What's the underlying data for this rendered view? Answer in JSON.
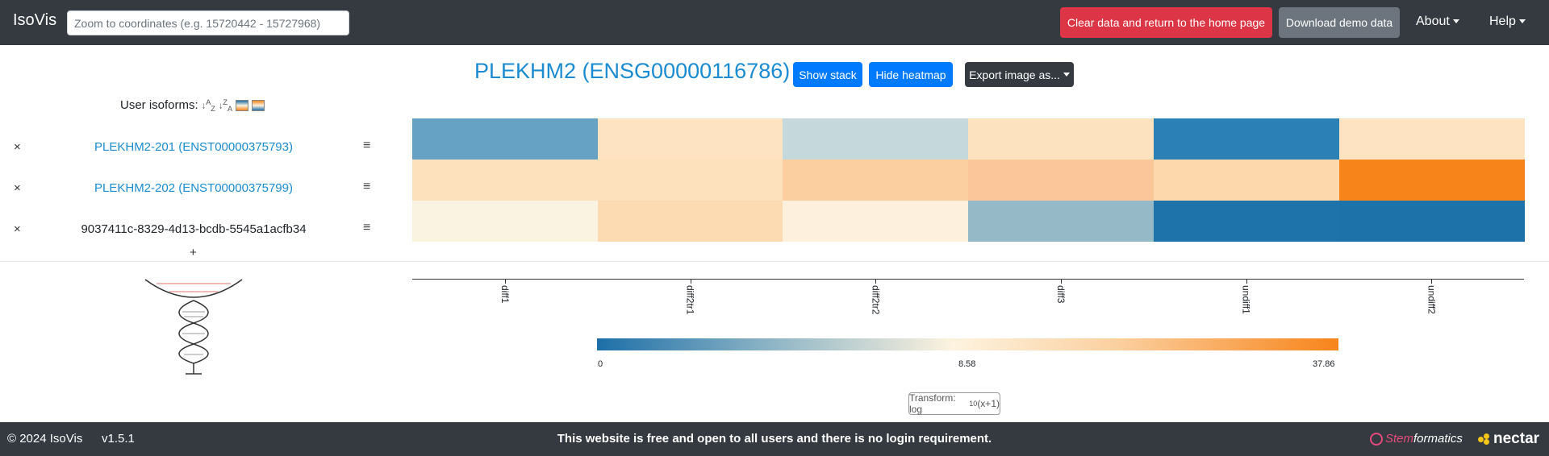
{
  "navbar": {
    "brand": "IsoVis",
    "search_placeholder": "Zoom to coordinates (e.g. 15720442 - 15727968)",
    "clear_button": "Clear data and return to the home page",
    "download_button": "Download demo data",
    "about": "About",
    "help": "Help"
  },
  "toolbar": {
    "gene_title": "PLEKHM2 (ENSG00000116786)",
    "show_stack": "Show stack",
    "hide_heatmap": "Hide heatmap",
    "export": "Export image as..."
  },
  "isoforms": {
    "header": "User isoforms:",
    "sort_az": "↓A↓Z",
    "sort_za": "↓Z↓A",
    "rows": [
      {
        "remove": "×",
        "name": "PLEKHM2-201 (ENST00000375793)",
        "menu": "≡"
      },
      {
        "remove": "×",
        "name": "PLEKHM2-202 (ENST00000375799)",
        "menu": "≡"
      },
      {
        "remove": "×",
        "name": "9037411c-8329-4d13-bcdb-5545a1acfb34",
        "menu": "≡"
      }
    ],
    "add": "+"
  },
  "chart_data": {
    "type": "heatmap",
    "columns": [
      "diff1",
      "diff2tr1",
      "diff2tr2",
      "diff3",
      "undiff1",
      "undiff2"
    ],
    "rows": [
      "PLEKHM2-201 (ENST00000375793)",
      "PLEKHM2-202 (ENST00000375799)",
      "9037411c-8329-4d13-bcdb-5545a1acfb34"
    ],
    "colors": [
      [
        "#66a2c4",
        "#fde3c1",
        "#c5d8db",
        "#fde2c0",
        "#2b80b5",
        "#fde3c1"
      ],
      [
        "#fde1bd",
        "#fde1bd",
        "#fbcfa0",
        "#fbc79a",
        "#fdd8ad",
        "#f7841a"
      ],
      [
        "#fbf3e2",
        "#fcdab2",
        "#fdf1dd",
        "#95b9c7",
        "#1e73ab",
        "#1e72aa"
      ]
    ],
    "colorscale": {
      "min_label": "0",
      "mid_label": "8.58",
      "max_label": "37.86",
      "min_color": "#1d6fa8",
      "mid_color": "#fdf3df",
      "max_color": "#f7841a"
    }
  },
  "transform": {
    "prefix": "Transform: log",
    "sub": "10",
    "suffix": "(x+1)"
  },
  "footer": {
    "copyright": "© 2024 IsoVis",
    "version": "v1.5.1",
    "message": "This website is free and open to all users and there is no login requirement.",
    "stemformatics_s": "Stem",
    "stemformatics_rest": "formatics",
    "nectar": "nectar"
  }
}
